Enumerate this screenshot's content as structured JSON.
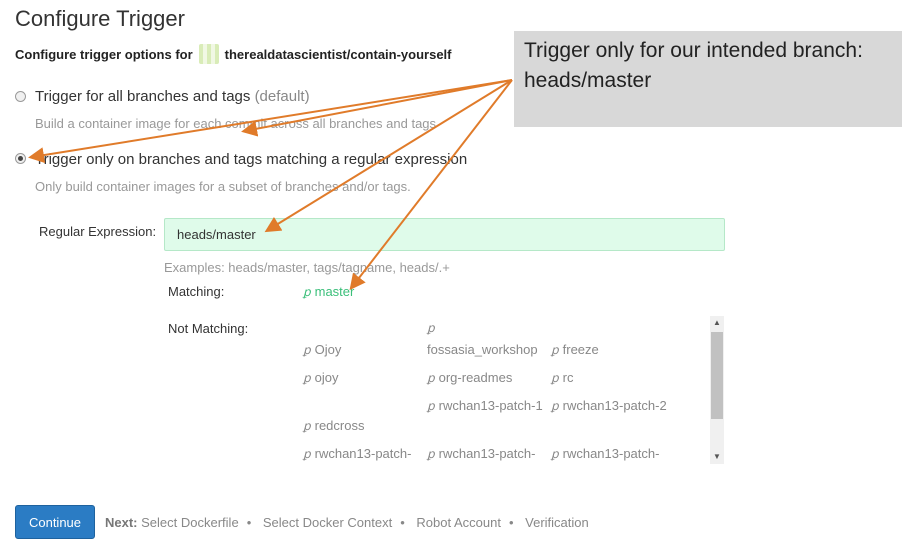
{
  "page": {
    "title": "Configure Trigger"
  },
  "subtitle": {
    "prefix": "Configure trigger options for",
    "repo": "therealdatascientist/contain-yourself"
  },
  "options": [
    {
      "label": "Trigger for all branches and tags",
      "suffix": "(default)",
      "description": "Build a container image for each commit across all branches and tags",
      "selected": false
    },
    {
      "label": "Trigger only on branches and tags matching a regular expression",
      "suffix": "",
      "description": "Only build container images for a subset of branches and/or tags.",
      "selected": true
    }
  ],
  "regex": {
    "label": "Regular Expression:",
    "value": "heads/master",
    "examples": "Examples: heads/master, tags/tagname, heads/.+"
  },
  "matching": {
    "label": "Matching:",
    "branches": [
      "master"
    ],
    "color": "#3bbf7a"
  },
  "not_matching": {
    "label": "Not Matching:",
    "rows": [
      [
        "Ojoy",
        "fossasia_workshop",
        "freeze"
      ],
      [
        "ojoy",
        "org-readmes",
        "rc"
      ],
      [
        "redcross",
        "rwchan13-patch-1",
        "rwchan13-patch-2"
      ],
      [
        "rwchan13-patch-",
        "rwchan13-patch-",
        "rwchan13-patch-"
      ]
    ]
  },
  "footer": {
    "continue_label": "Continue",
    "next_label": "Next:",
    "steps": [
      "Select Dockerfile",
      "Select Docker Context",
      "Robot Account",
      "Verification"
    ]
  },
  "annotation": {
    "text": "Trigger only for our intended branch: heads/master",
    "arrow_color": "#e07b2a",
    "box_color": "#d8d8d8"
  },
  "icons": {
    "branch": "ꝑ",
    "scroll_up": "▲",
    "scroll_down": "▼"
  },
  "colors": {
    "primary": "#2b7cc4",
    "regex_bg": "#dffbea"
  }
}
